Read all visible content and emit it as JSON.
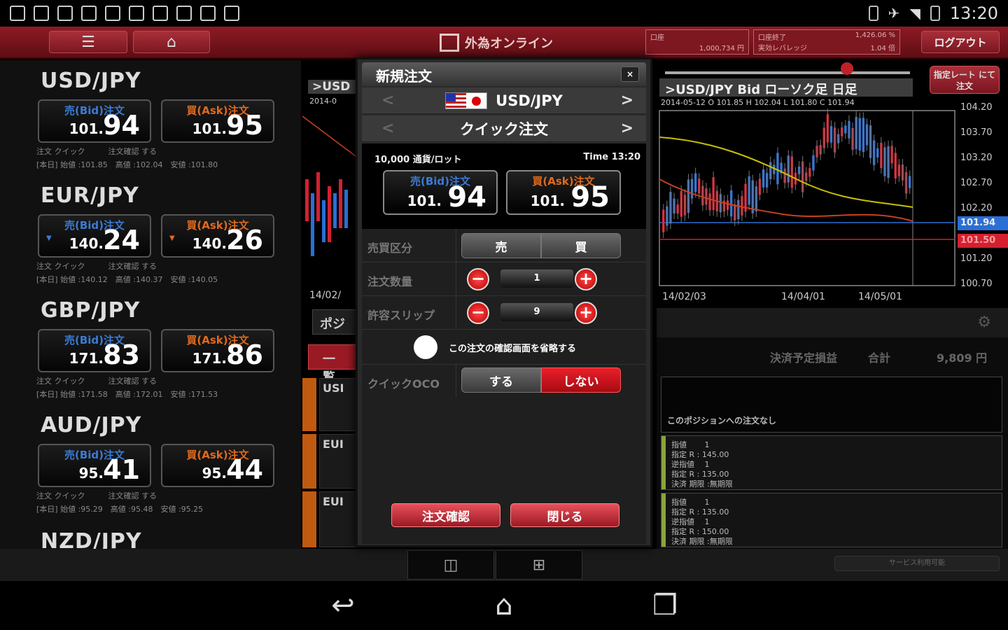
{
  "status": {
    "time": "13:20"
  },
  "header": {
    "logo_text": "外為オンライン",
    "logout_label": "ログアウト",
    "info_left": [
      "口座",
      "1,000,734 円"
    ],
    "info_right": [
      "口座終了",
      "1,426.06 %",
      "実効レバレッジ",
      "1.04 倍"
    ]
  },
  "rates": [
    {
      "pair": "USD/JPY",
      "bid_label": "売(Bid)注文",
      "ask_label": "買(Ask)注文",
      "bid_int": "101.",
      "bid_dec": "94",
      "ask_int": "101.",
      "ask_dec": "95",
      "line1": "注文 クイック　　　注文確認 する",
      "line2": "[本日] 始値 :101.85　高値 :102.04　安値 :101.80",
      "arrow_bid": "",
      "arrow_ask": ""
    },
    {
      "pair": "EUR/JPY",
      "bid_label": "売(Bid)注文",
      "ask_label": "買(Ask)注文",
      "bid_int": "140.",
      "bid_dec": "24",
      "ask_int": "140.",
      "ask_dec": "26",
      "line1": "注文 クイック　　　注文確認 する",
      "line2": "[本日] 始値 :140.12　高値 :140.37　安値 :140.05",
      "arrow_bid": "▼",
      "arrow_ask": "▼"
    },
    {
      "pair": "GBP/JPY",
      "bid_label": "売(Bid)注文",
      "ask_label": "買(Ask)注文",
      "bid_int": "171.",
      "bid_dec": "83",
      "ask_int": "171.",
      "ask_dec": "86",
      "line1": "注文 クイック　　　注文確認 する",
      "line2": "[本日] 始値 :171.58　高値 :172.01　安値 :171.53",
      "arrow_bid": "",
      "arrow_ask": ""
    },
    {
      "pair": "AUD/JPY",
      "bid_label": "売(Bid)注文",
      "ask_label": "買(Ask)注文",
      "bid_int": "95.",
      "bid_dec": "41",
      "ask_int": "95.",
      "ask_dec": "44",
      "line1": "注文 クイック　　　注文確認 する",
      "line2": "[本日] 始値 :95.29　高値 :95.48　安値 :95.25",
      "arrow_bid": "",
      "arrow_ask": ""
    }
  ],
  "next_pair": "NZD/JPY",
  "mid": {
    "chart_title": ">USD",
    "date": "2014-0",
    "xlabel": "14/02/",
    "tab_label": "ポジ",
    "red_tab": "一覧",
    "cells": [
      "USI",
      "EUI",
      "EUI"
    ]
  },
  "chart": {
    "title": ">USD/JPY Bid ローソク足 日足",
    "sub": "2014-05-12 O 101.85 H 102.04 L 101.80 C 101.94",
    "rate_btn": "指定レート にて注文",
    "y_labels": [
      "104.20",
      "103.70",
      "103.20",
      "102.70",
      "102.20",
      "101.20",
      "100.70"
    ],
    "y_tag_bid": "101.94",
    "y_tag_ask": "101.50",
    "x_labels": [
      "14/02/03",
      "14/04/01",
      "14/05/01"
    ],
    "colors": {
      "up": "#2a6fd6",
      "down": "#d42030",
      "ma1": "#c9c000",
      "ma2": "#c84020"
    }
  },
  "positions": {
    "summary_label": "決済予定損益",
    "total_label": "合計",
    "total_value": "9,809 円",
    "no_position": "このポジションへの注文なし",
    "cards": [
      [
        "指値 　　1",
        "指定 R : 145.00",
        "逆指値 　1",
        "指定 R : 135.00",
        "決済 期限 :無期限"
      ],
      [
        "指値 　　1",
        "指定 R : 135.00",
        "逆指値 　1",
        "指定 R : 150.00",
        "決済 期限 :無期限"
      ]
    ],
    "service": "サービス利用可能"
  },
  "modal": {
    "title": "新規注文",
    "close": "×",
    "pair": "USD/JPY",
    "mode": "クイック注文",
    "lot": "10,000 通貨/ロット",
    "time": "Time 13:20",
    "bid_label": "売(Bid)注文",
    "ask_label": "買(Ask)注文",
    "bid_int": "101.",
    "bid_dec": "94",
    "ask_int": "101.",
    "ask_dec": "95",
    "side_label": "売買区分",
    "sell": "売",
    "buy": "買",
    "qty_label": "注文数量",
    "qty": "1",
    "slip_label": "許容スリップ",
    "slip": "9",
    "skip_confirm": "この注文の確認画面を省略する",
    "oco_label": "クイックOCO",
    "oco_on": "する",
    "oco_off": "しない",
    "confirm_btn": "注文確認",
    "close_btn": "閉じる"
  }
}
